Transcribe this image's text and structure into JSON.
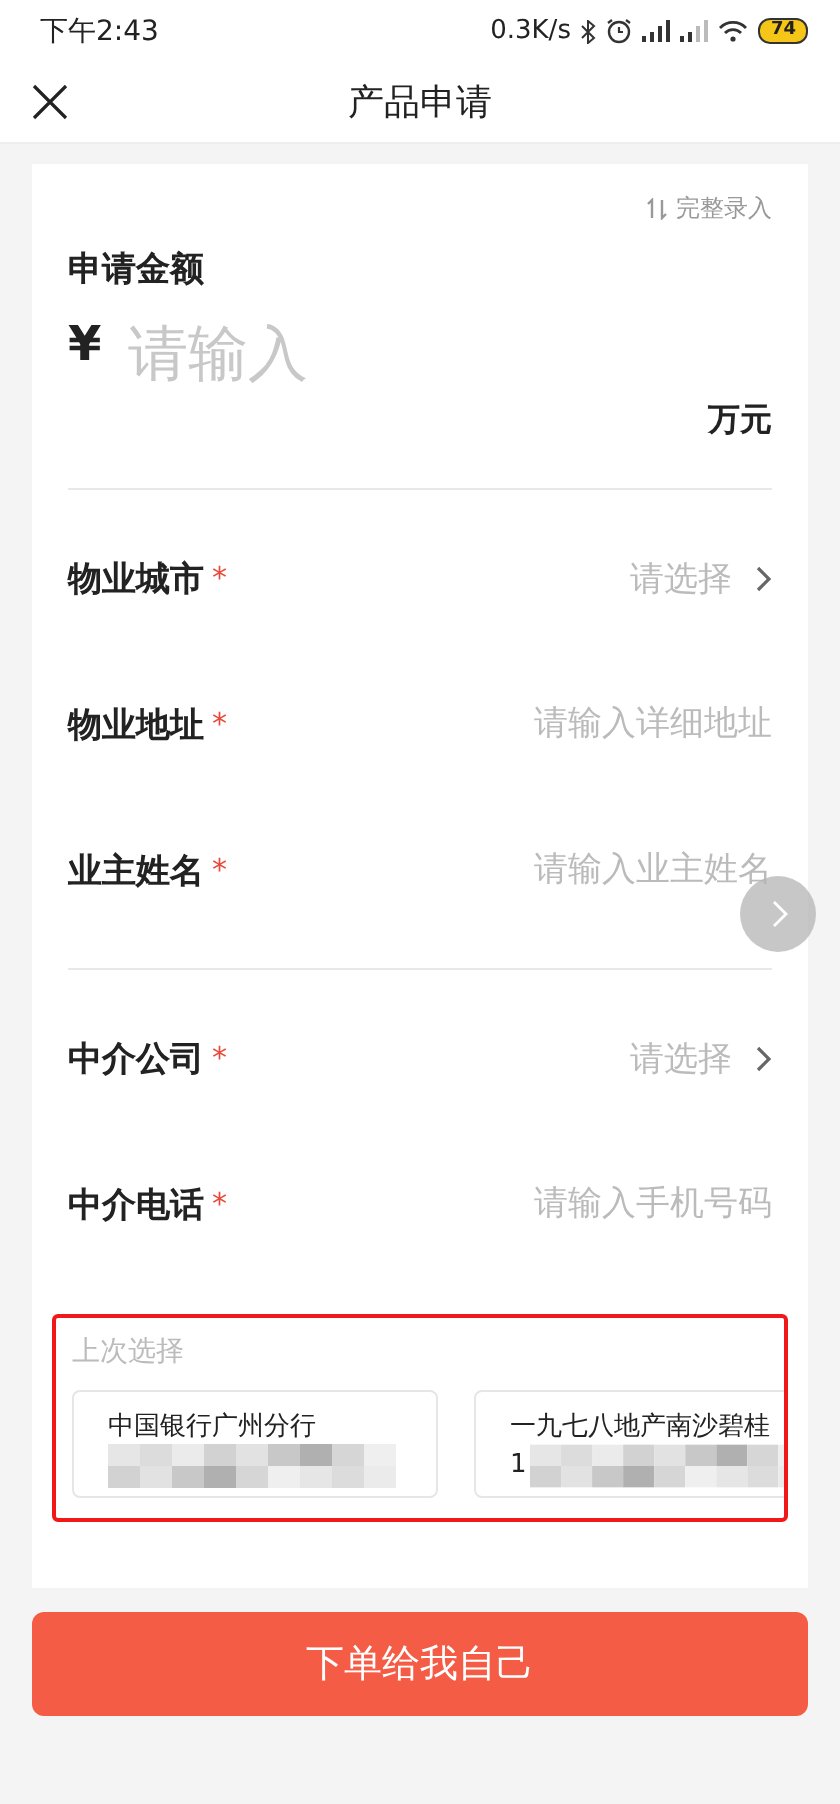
{
  "status_bar": {
    "time": "下午2:43",
    "speed": "0.3K/s",
    "battery": "74"
  },
  "header": {
    "title": "产品申请"
  },
  "form": {
    "full_entry": "完整录入",
    "amount": {
      "label": "申请金额",
      "currency": "¥",
      "placeholder": "请输入",
      "unit": "万元"
    },
    "groups": [
      {
        "fields": [
          {
            "label": "物业城市",
            "required_mark": "*",
            "placeholder": "请选择",
            "kind": "select"
          },
          {
            "label": "物业地址",
            "required_mark": "*",
            "placeholder": "请输入详细地址",
            "kind": "input"
          },
          {
            "label": "业主姓名",
            "required_mark": "*",
            "placeholder": "请输入业主姓名",
            "kind": "input"
          }
        ]
      },
      {
        "fields": [
          {
            "label": "中介公司",
            "required_mark": "*",
            "placeholder": "请选择",
            "kind": "select"
          },
          {
            "label": "中介电话",
            "required_mark": "*",
            "placeholder": "请输入手机号码",
            "kind": "input"
          }
        ]
      }
    ]
  },
  "recent": {
    "title": "上次选择",
    "items": [
      {
        "name": "中国银行广州分行"
      },
      {
        "name": "一九七八地产南沙碧桂",
        "detail": "1"
      }
    ]
  },
  "submit": "下单给我自己"
}
